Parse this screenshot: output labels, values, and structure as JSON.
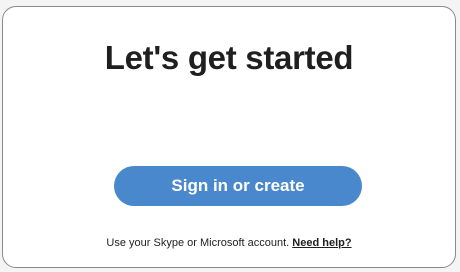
{
  "page": {
    "title": "Let's get started",
    "primary_button": "Sign in or create",
    "footer_text": "Use your Skype or Microsoft account.",
    "help_link": "Need help?"
  },
  "colors": {
    "button_background": "#4a88ce",
    "button_text": "#ffffff",
    "card_border": "#8a8a8a"
  }
}
